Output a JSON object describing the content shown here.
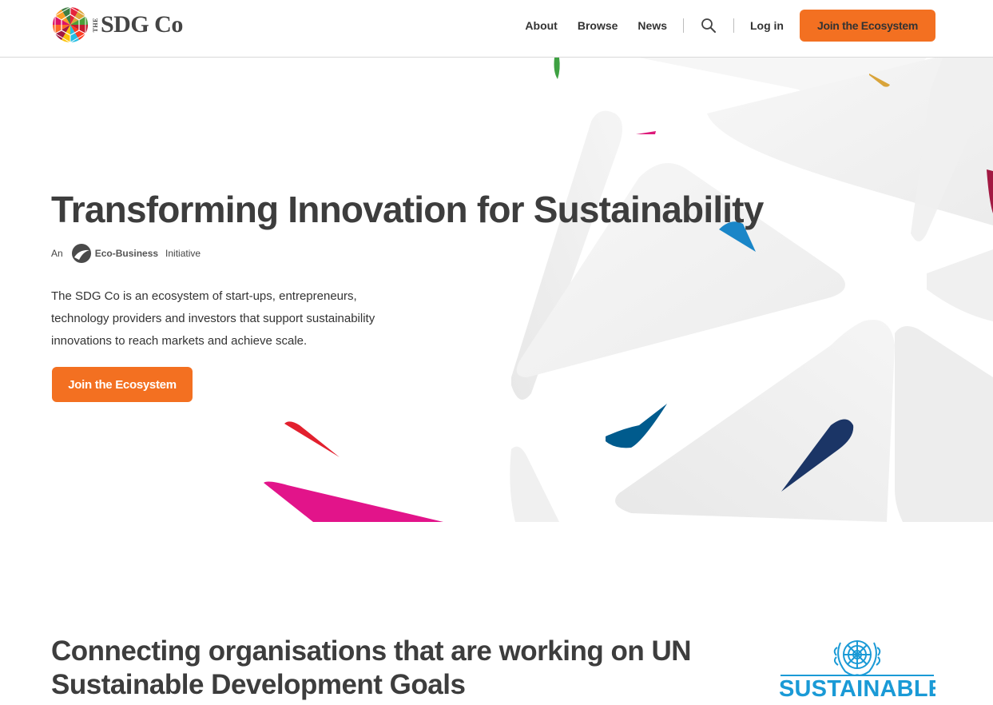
{
  "brand": {
    "the": "THE",
    "name": "SDG Co"
  },
  "nav": {
    "about": "About",
    "browse": "Browse",
    "news": "News",
    "login": "Log in",
    "cta": "Join the Ecosystem"
  },
  "hero": {
    "title": "Transforming Innovation for Sustainability",
    "byline_prefix": "An",
    "byline_partner": "Eco-Business",
    "byline_suffix": "Initiative",
    "description": "The SDG Co is an ecosystem of start-ups, entrepreneurs, technology providers and investors that support sustainability innovations to reach markets and achieve scale.",
    "cta": "Join the Ecosystem"
  },
  "section2": {
    "title": "Connecting organisations that are working on UN Sustainable Development Goals",
    "un_logo_text": "SUSTAINABLE"
  },
  "colors": {
    "accent": "#f37021",
    "text": "#3d3d3d",
    "un_blue": "#1a9ad6"
  },
  "icons": [
    "sdg-wheel-logo-icon",
    "search-icon",
    "eco-business-logo-icon",
    "un-emblem-icon"
  ]
}
